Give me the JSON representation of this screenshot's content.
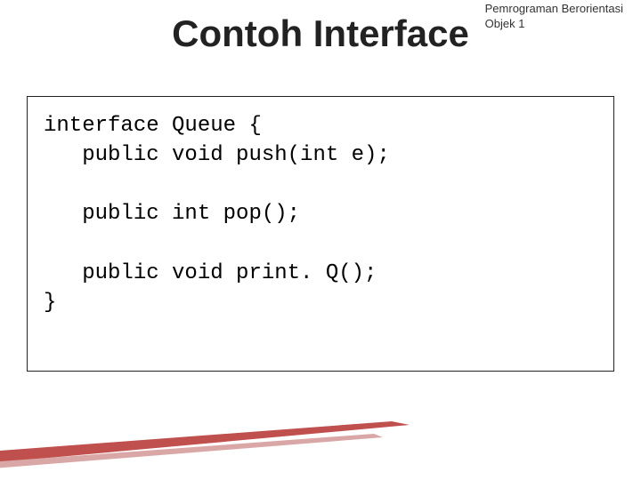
{
  "header": {
    "line1": "Pemrograman Berorientasi",
    "line2": "Objek 1"
  },
  "title": "Contoh Interface",
  "code": {
    "l1": "interface Queue {",
    "l2": "   public void push(int e);",
    "l3": "",
    "l4": "   public int pop();",
    "l5": "",
    "l6": "   public void print. Q();",
    "l7": "}"
  },
  "colors": {
    "accent": "#c0504d"
  }
}
